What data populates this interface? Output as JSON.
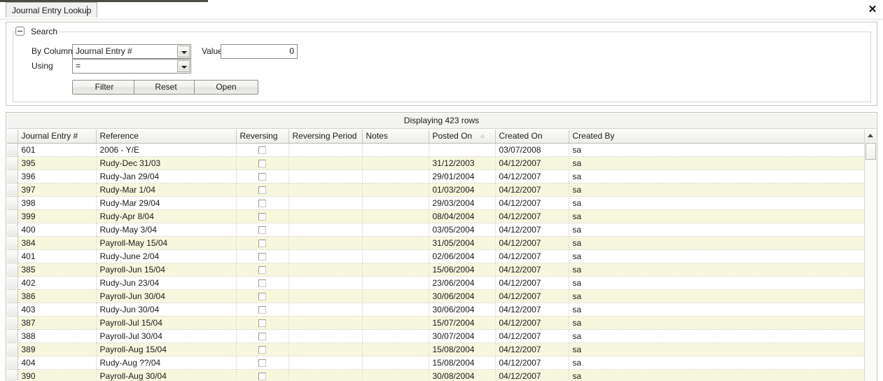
{
  "window": {
    "tab_label": "Journal Entry Lookup",
    "close_label": "✕"
  },
  "search": {
    "group_title": "Search",
    "by_column_label": "By Column",
    "by_column_value": "Journal Entry #",
    "using_label": "Using",
    "using_value": "=",
    "value_label": "Value",
    "value_text": "0",
    "filter_label": "Filter",
    "reset_label": "Reset",
    "open_label": "Open"
  },
  "grid": {
    "status_text": "Displaying 423 rows",
    "sorted_column": "Posted On",
    "sort_direction": "asc",
    "columns": [
      "Journal Entry #",
      "Reference",
      "Reversing",
      "Reversing Period",
      "Notes",
      "Posted On",
      "Created On",
      "Created By"
    ],
    "rows": [
      {
        "journal_entry": "601",
        "reference": "2006 - Y/E",
        "reversing": false,
        "reversing_period": "",
        "notes": "",
        "posted_on": "",
        "created_on": "03/07/2008",
        "created_by": "sa"
      },
      {
        "journal_entry": "395",
        "reference": "Rudy-Dec 31/03",
        "reversing": false,
        "reversing_period": "",
        "notes": "",
        "posted_on": "31/12/2003",
        "created_on": "04/12/2007",
        "created_by": "sa"
      },
      {
        "journal_entry": "396",
        "reference": "Rudy-Jan 29/04",
        "reversing": false,
        "reversing_period": "",
        "notes": "",
        "posted_on": "29/01/2004",
        "created_on": "04/12/2007",
        "created_by": "sa"
      },
      {
        "journal_entry": "397",
        "reference": "Rudy-Mar 1/04",
        "reversing": false,
        "reversing_period": "",
        "notes": "",
        "posted_on": "01/03/2004",
        "created_on": "04/12/2007",
        "created_by": "sa"
      },
      {
        "journal_entry": "398",
        "reference": "Rudy-Mar 29/04",
        "reversing": false,
        "reversing_period": "",
        "notes": "",
        "posted_on": "29/03/2004",
        "created_on": "04/12/2007",
        "created_by": "sa"
      },
      {
        "journal_entry": "399",
        "reference": "Rudy-Apr 8/04",
        "reversing": false,
        "reversing_period": "",
        "notes": "",
        "posted_on": "08/04/2004",
        "created_on": "04/12/2007",
        "created_by": "sa"
      },
      {
        "journal_entry": "400",
        "reference": "Rudy-May 3/04",
        "reversing": false,
        "reversing_period": "",
        "notes": "",
        "posted_on": "03/05/2004",
        "created_on": "04/12/2007",
        "created_by": "sa"
      },
      {
        "journal_entry": "384",
        "reference": "Payroll-May 15/04",
        "reversing": false,
        "reversing_period": "",
        "notes": "",
        "posted_on": "31/05/2004",
        "created_on": "04/12/2007",
        "created_by": "sa"
      },
      {
        "journal_entry": "401",
        "reference": "Rudy-June 2/04",
        "reversing": false,
        "reversing_period": "",
        "notes": "",
        "posted_on": "02/06/2004",
        "created_on": "04/12/2007",
        "created_by": "sa"
      },
      {
        "journal_entry": "385",
        "reference": "Payroll-Jun 15/04",
        "reversing": false,
        "reversing_period": "",
        "notes": "",
        "posted_on": "15/06/2004",
        "created_on": "04/12/2007",
        "created_by": "sa"
      },
      {
        "journal_entry": "402",
        "reference": "Rudy-Jun 23/04",
        "reversing": false,
        "reversing_period": "",
        "notes": "",
        "posted_on": "23/06/2004",
        "created_on": "04/12/2007",
        "created_by": "sa"
      },
      {
        "journal_entry": "386",
        "reference": "Payroll-Jun 30/04",
        "reversing": false,
        "reversing_period": "",
        "notes": "",
        "posted_on": "30/06/2004",
        "created_on": "04/12/2007",
        "created_by": "sa"
      },
      {
        "journal_entry": "403",
        "reference": "Rudy-Jun 30/04",
        "reversing": false,
        "reversing_period": "",
        "notes": "",
        "posted_on": "30/06/2004",
        "created_on": "04/12/2007",
        "created_by": "sa"
      },
      {
        "journal_entry": "387",
        "reference": "Payroll-Jul 15/04",
        "reversing": false,
        "reversing_period": "",
        "notes": "",
        "posted_on": "15/07/2004",
        "created_on": "04/12/2007",
        "created_by": "sa"
      },
      {
        "journal_entry": "388",
        "reference": "Payroll-Jul 30/04",
        "reversing": false,
        "reversing_period": "",
        "notes": "",
        "posted_on": "30/07/2004",
        "created_on": "04/12/2007",
        "created_by": "sa"
      },
      {
        "journal_entry": "389",
        "reference": "Payroll-Aug 15/04",
        "reversing": false,
        "reversing_period": "",
        "notes": "",
        "posted_on": "15/08/2004",
        "created_on": "04/12/2007",
        "created_by": "sa"
      },
      {
        "journal_entry": "404",
        "reference": "Rudy-Aug ??/04",
        "reversing": false,
        "reversing_period": "",
        "notes": "",
        "posted_on": "15/08/2004",
        "created_on": "04/12/2007",
        "created_by": "sa"
      },
      {
        "journal_entry": "390",
        "reference": "Payroll-Aug 30/04",
        "reversing": false,
        "reversing_period": "",
        "notes": "",
        "posted_on": "30/08/2004",
        "created_on": "04/12/2007",
        "created_by": "sa"
      }
    ]
  }
}
